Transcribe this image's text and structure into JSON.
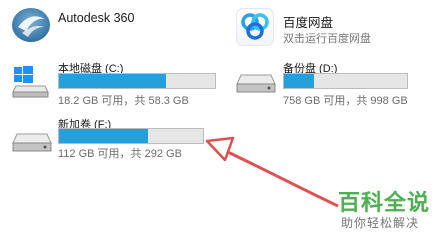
{
  "apps": [
    {
      "name": "Autodesk 360",
      "subtitle": ""
    },
    {
      "name": "百度网盘",
      "subtitle": "双击运行百度网盘"
    }
  ],
  "drives": [
    {
      "label": "本地磁盘 (C:)",
      "space_text": "18.2 GB 可用，共 58.3 GB",
      "used_fraction": 0.688
    },
    {
      "label": "备份盘 (D:)",
      "space_text": "758 GB 可用，共 998 GB",
      "used_fraction": 0.24
    },
    {
      "label": "新加卷 (F:)",
      "space_text": "112 GB 可用，共 292 GB",
      "used_fraction": 0.616
    }
  ],
  "watermark": {
    "main": "百科全说",
    "sub": "助你轻松解决"
  },
  "colors": {
    "bar_fill": "#26a0da",
    "annotation_arrow": "#e05050",
    "watermark": "#4caf50"
  }
}
